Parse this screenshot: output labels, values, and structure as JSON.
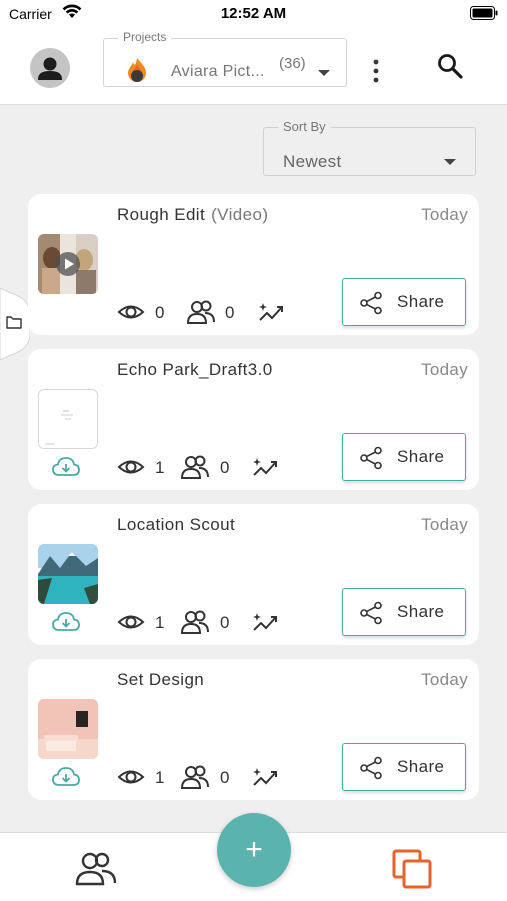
{
  "status_bar": {
    "carrier": "Carrier",
    "time": "12:52 AM"
  },
  "header": {
    "projects_label": "Projects",
    "project_name": "Aviara Pict...",
    "project_count": "(36)"
  },
  "sort": {
    "label": "Sort By",
    "value": "Newest"
  },
  "items": [
    {
      "title": "Rough Edit",
      "subtitle": "(Video)",
      "date": "Today",
      "views": "0",
      "viewers": "0",
      "share_label": "Share",
      "thumb": "video"
    },
    {
      "title": "Echo Park_Draft3.0",
      "subtitle": "",
      "date": "Today",
      "views": "1",
      "viewers": "0",
      "share_label": "Share",
      "thumb": "document"
    },
    {
      "title": "Location Scout",
      "subtitle": "",
      "date": "Today",
      "views": "1",
      "viewers": "0",
      "share_label": "Share",
      "thumb": "landscape"
    },
    {
      "title": "Set Design",
      "subtitle": "",
      "date": "Today",
      "views": "1",
      "viewers": "0",
      "share_label": "Share",
      "thumb": "room"
    }
  ],
  "fab_label": "+",
  "colors": {
    "accent": "#5ab4ad",
    "accent_dark": "#4aa9a3",
    "brand_orange": "#e8622c",
    "background": "#efefef"
  },
  "icons": [
    "wifi-icon",
    "battery-icon",
    "avatar-icon",
    "project-logo-icon",
    "kebab-menu-icon",
    "search-icon",
    "folder-icon",
    "play-icon",
    "cloud-download-icon",
    "eye-icon",
    "viewers-icon",
    "activity-icon",
    "share-icon",
    "people-icon",
    "copy-icon"
  ]
}
